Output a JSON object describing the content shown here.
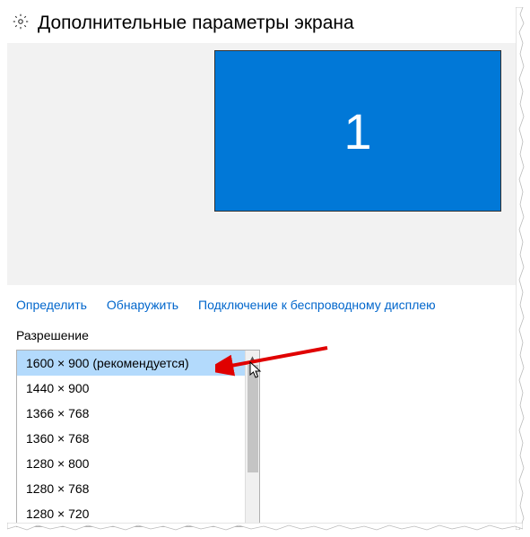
{
  "header": {
    "title": "Дополнительные параметры экрана"
  },
  "display": {
    "monitor_number": "1"
  },
  "links": {
    "identify": "Определить",
    "detect": "Обнаружить",
    "wireless": "Подключение к беспроводному дисплею"
  },
  "resolution": {
    "label": "Разрешение",
    "selected_index": 0,
    "options": [
      "1600 × 900 (рекомендуется)",
      "1440 × 900",
      "1366 × 768",
      "1360 × 768",
      "1280 × 800",
      "1280 × 768",
      "1280 × 720"
    ]
  }
}
